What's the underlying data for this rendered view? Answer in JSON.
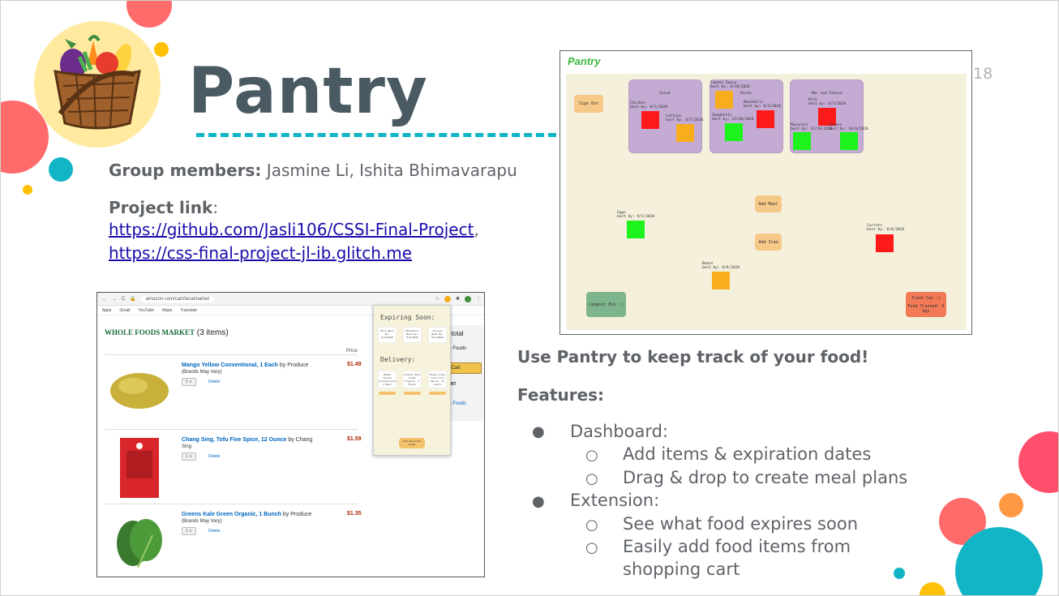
{
  "slide": {
    "title": "Pantry",
    "number": "18"
  },
  "group": {
    "label": "Group members:",
    "names": " Jasmine Li, Ishita Bhimavarapu"
  },
  "project": {
    "label": "Project link",
    "colon": ":",
    "link1": "https://github.com/Jasli106/CSSI-Final-Project",
    "comma": ",",
    "link2": "https://css-final-project-jl-ib.glitch.me"
  },
  "amazon": {
    "url": "amazon.com/cart/localmarket",
    "bookmarks": [
      "Apps",
      "Gmail",
      "YouTube",
      "Maps",
      "Translate"
    ],
    "store_brand": "WHOLE FOODS MARKET",
    "item_count": " (3 items)",
    "price_header": "Price",
    "items": [
      {
        "name": "Mango Yellow Conventional, 1 Each",
        "by": " by Produce",
        "sub": "(Brands May Vary)",
        "qty": "1",
        "delete": "Delete",
        "price": "$1.49"
      },
      {
        "name": "Chang Sing, Tofu Five Spice, 12 Ounce",
        "by": " by Chang",
        "sub": "Sing",
        "qty": "1",
        "delete": "Delete",
        "price": "$1.59"
      },
      {
        "name": "Greens Kale Green Organic, 1 Bunch",
        "by": " by Produce",
        "sub": "(Brands May Vary)",
        "qty": "1",
        "delete": "Delete",
        "price": "$1.35"
      }
    ],
    "side": {
      "subtotal": "btotal",
      "foods": "le Foods",
      "cart_btn": "t Cart",
      "ont": "ONT",
      "foods2": "le Foods"
    },
    "extension": {
      "expiring_title": "Expiring Soon:",
      "expiring_cards": [
        "Milk Best By: 8/5/2020",
        "Meatballs Best By: 8/3/2020",
        "Chicken Best By: 8/1/2020"
      ],
      "delivery_title": "Delivery:",
      "delivery_cards": [
        "Mango Yellow Conventional, 1 Each",
        "Greens Kale Green Organic, 1 Bunch",
        "Chang Sing, Tofu Five Spice, 12 Ounce"
      ],
      "add_button": "Add Selected Items"
    }
  },
  "pantry_app": {
    "title": "Pantry",
    "sign_out": "Sign Out",
    "add_meal": "Add Meal",
    "add_item": "Add Item",
    "compost": "Compost Bin :)",
    "trash": "Trash Can :(",
    "food_trashed": "Food Trashed: 0 kgs",
    "meals": [
      {
        "title": "Salad",
        "items": [
          {
            "label": "Chicken\nbest by: 8/1/2020",
            "status": "expired"
          },
          {
            "label": "Lettuce\nbest by: 8/7/2020",
            "status": "soon"
          }
        ]
      },
      {
        "title": "Pasta",
        "items": [
          {
            "label": "Tomato Sauce\nbest by: 8/10/2020",
            "status": "soon"
          },
          {
            "label": "Meatballs\nbest by: 8/3/2020",
            "status": "expired"
          },
          {
            "label": "Spaghetti\nbest by: 12/30/2020",
            "status": "fresh"
          }
        ]
      },
      {
        "title": "Mac and Cheese",
        "items": [
          {
            "label": "Milk\nbest by: 8/5/2020",
            "status": "expired"
          },
          {
            "label": "Macaroni\nbest by: 12/30/2020",
            "status": "fresh"
          },
          {
            "label": "Cheese\nbest by: 10/6/2020",
            "status": "fresh"
          }
        ]
      }
    ],
    "loose_items": [
      {
        "label": "Eggs\nbest by: 9/1/2020",
        "status": "fresh"
      },
      {
        "label": "Carrots\nbest by: 8/6/2020",
        "status": "expired"
      },
      {
        "label": "Beans\nbest by: 8/9/2020",
        "status": "soon"
      }
    ],
    "colors": {
      "expired": "#ff1a1a",
      "soon": "#f7ad1c",
      "fresh": "#1df21d",
      "meal_box": "#c3abd4",
      "canvas": "#f5f0dc"
    }
  },
  "right": {
    "tagline": "Use Pantry to keep track of your food!",
    "features_title": "Features:",
    "dashboard": "Dashboard:",
    "dashboard_items": [
      "Add items & expiration dates",
      "Drag & drop to create meal plans"
    ],
    "extension": "Extension:",
    "extension_items": [
      "See what food expires soon",
      "Easily add food items from",
      "shopping cart"
    ],
    "bullet_primary": "●",
    "bullet_secondary": "○"
  },
  "decor_colors": [
    "#ff5f6d",
    "#ffc107",
    "#12b5c6",
    "#ff9843",
    "#ffeaa0"
  ]
}
